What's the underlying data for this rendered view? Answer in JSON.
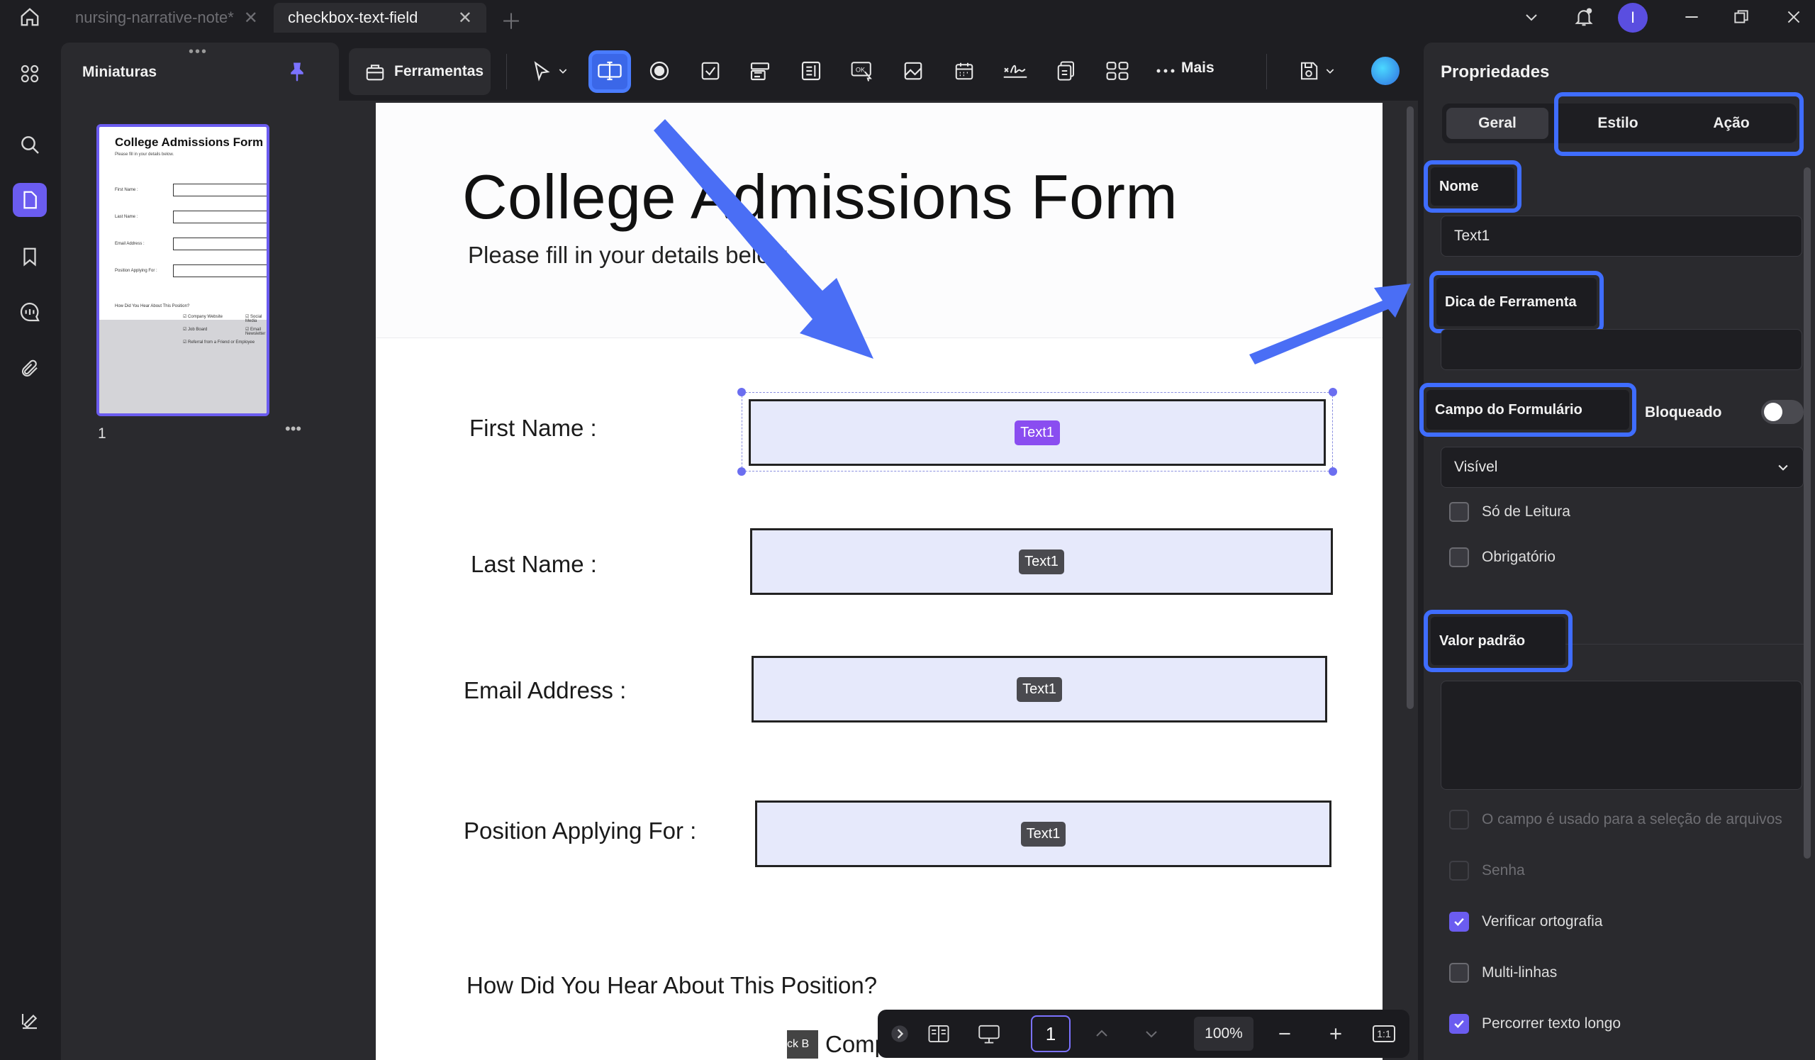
{
  "tabs": [
    {
      "label": "nursing-narrative-note*",
      "active": false
    },
    {
      "label": "checkbox-text-field",
      "active": true
    }
  ],
  "user": {
    "initial": "I"
  },
  "thumbnails": {
    "title": "Miniaturas",
    "page_label": "1",
    "preview": {
      "title": "College Admissions Form",
      "subtitle": "Please fill in your details below.",
      "labels": [
        "First Name :",
        "Last Name :",
        "Email Address :",
        "Position Applying For :"
      ],
      "question": "How Did You Hear About This Position?",
      "options": [
        "Company Website",
        "Social Media",
        "Job Board",
        "Email Newsletter",
        "Referral from a Friend or Employee"
      ]
    }
  },
  "toolbar": {
    "tools_label": "Ferramentas",
    "more_label": "Mais"
  },
  "document": {
    "title": "College Admissions Form",
    "subtitle": "Please fill in your details below.",
    "fields": [
      {
        "label": "First Name :",
        "tag": "Text1",
        "selected": true
      },
      {
        "label": "Last Name :",
        "tag": "Text1",
        "selected": false
      },
      {
        "label": "Email Address :",
        "tag": "Text1",
        "selected": false
      },
      {
        "label": "Position Applying For :",
        "tag": "Text1",
        "selected": false
      }
    ],
    "question": "How Did You Hear About This Position?",
    "partial_checkbox_label": "ck B",
    "partial_option_text": "Comp"
  },
  "navbar": {
    "page": "1",
    "zoom": "100%",
    "fit_label": "1:1"
  },
  "properties": {
    "title": "Propriedades",
    "tabs": [
      "Geral",
      "Estilo",
      "Ação"
    ],
    "active_tab": "Geral",
    "name_label": "Nome",
    "name_value": "Text1",
    "tooltip_label": "Dica de Ferramenta",
    "tooltip_value": "",
    "form_field_label": "Campo do Formulário",
    "locked_label": "Bloqueado",
    "locked": false,
    "visibility_value": "Visível",
    "read_only_label": "Só de Leitura",
    "required_label": "Obrigatório",
    "default_value_label": "Valor padrão",
    "default_value": "",
    "file_select_label": "O campo é usado para a seleção de arquivos",
    "password_label": "Senha",
    "spell_check_label": "Verificar ortografia",
    "multiline_label": "Multi-linhas",
    "scroll_long_label": "Percorrer texto longo",
    "read_only": false,
    "required": false,
    "file_select": false,
    "password": false,
    "spell_check": true,
    "multiline": false,
    "scroll_long": true
  },
  "colors": {
    "accent": "#6b5cf0",
    "highlight": "#3f6dff",
    "field_fill": "#e6e9fb"
  }
}
